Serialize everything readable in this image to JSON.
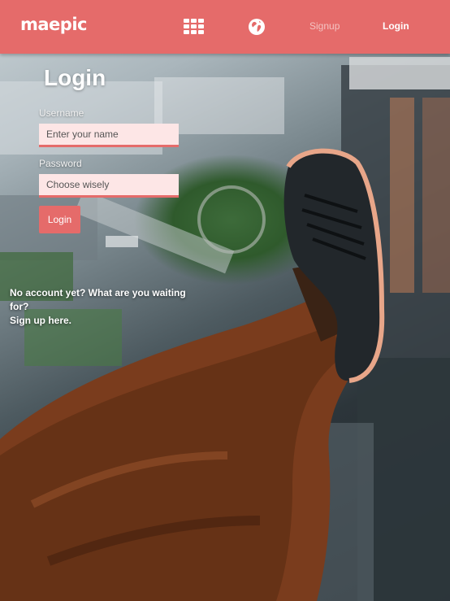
{
  "header": {
    "logo": "maepic",
    "nav": {
      "signup": "Signup",
      "login": "Login"
    },
    "icons": [
      "apps-grid-icon",
      "globe-icon"
    ]
  },
  "login_form": {
    "title": "Login",
    "username_label": "Username",
    "username_placeholder": "Enter your name",
    "password_label": "Password",
    "password_placeholder": "Choose wisely",
    "submit_label": "Login"
  },
  "signup_prompt": {
    "text": "No account yet? What are you waiting for?",
    "link": "Sign up here."
  },
  "colors": {
    "brand": "#e56b6a",
    "input_bg": "#fde6e6",
    "text_light": "#ffffff"
  }
}
